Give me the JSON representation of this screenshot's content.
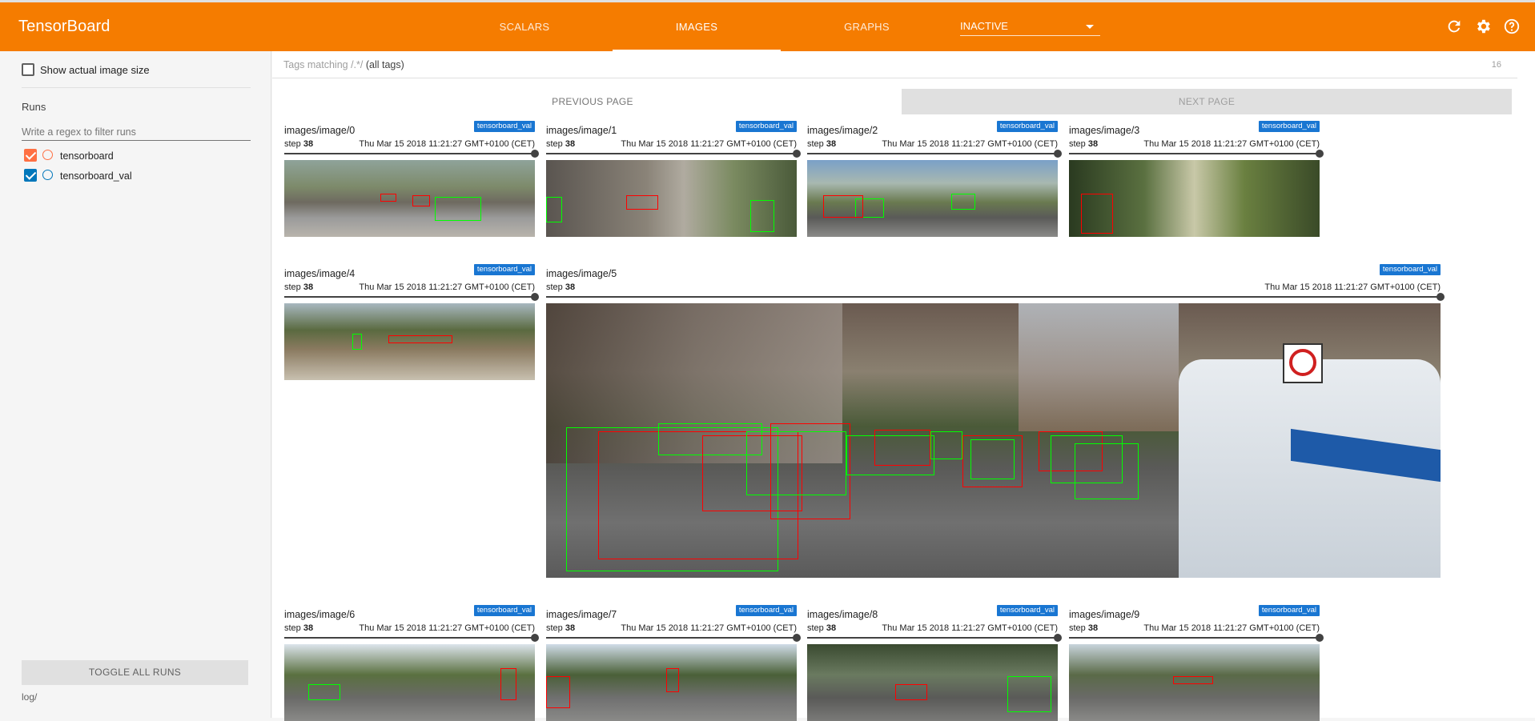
{
  "topbar": {
    "brand": "TensorBoard",
    "tabs": [
      {
        "label": "SCALARS"
      },
      {
        "label": "IMAGES"
      },
      {
        "label": "GRAPHS"
      }
    ],
    "inactive_label": "INACTIVE",
    "icons": [
      "refresh-icon",
      "settings-icon",
      "help-icon"
    ]
  },
  "sidebar": {
    "show_actual_size": "Show actual image size",
    "runs_title": "Runs",
    "regex_placeholder": "Write a regex to filter runs",
    "runs": [
      {
        "name": "tensorboard",
        "color": "#ff7043",
        "checked": true
      },
      {
        "name": "tensorboard_val",
        "color": "#0077bb",
        "checked": true
      }
    ],
    "toggle_all": "TOGGLE ALL RUNS",
    "logdir": "log/"
  },
  "main": {
    "tag_prefix": "Tags matching ",
    "tag_regex": "/.*/",
    "tag_suffix": " (all tags)",
    "tag_count": "16",
    "prev_page": "PREVIOUS PAGE",
    "next_page": "NEXT PAGE",
    "cards": [
      {
        "title": "images/image/0",
        "badge": "tensorboard_val",
        "step_label": "step",
        "step": "38",
        "wall": "Thu Mar 15 2018 11:21:27 GMT+0100 (CET)"
      },
      {
        "title": "images/image/1",
        "badge": "tensorboard_val",
        "step_label": "step",
        "step": "38",
        "wall": "Thu Mar 15 2018 11:21:27 GMT+0100 (CET)"
      },
      {
        "title": "images/image/2",
        "badge": "tensorboard_val",
        "step_label": "step",
        "step": "38",
        "wall": "Thu Mar 15 2018 11:21:27 GMT+0100 (CET)"
      },
      {
        "title": "images/image/3",
        "badge": "tensorboard_val",
        "step_label": "step",
        "step": "38",
        "wall": "Thu Mar 15 2018 11:21:27 GMT+0100 (CET)"
      },
      {
        "title": "images/image/4",
        "badge": "tensorboard_val",
        "step_label": "step",
        "step": "38",
        "wall": "Thu Mar 15 2018 11:21:27 GMT+0100 (CET)"
      },
      {
        "title": "images/image/5",
        "badge": "tensorboard_val",
        "step_label": "step",
        "step": "38",
        "wall": "Thu Mar 15 2018 11:21:27 GMT+0100 (CET)"
      },
      {
        "title": "images/image/6",
        "badge": "tensorboard_val",
        "step_label": "step",
        "step": "38",
        "wall": "Thu Mar 15 2018 11:21:27 GMT+0100 (CET)"
      },
      {
        "title": "images/image/7",
        "badge": "tensorboard_val",
        "step_label": "step",
        "step": "38",
        "wall": "Thu Mar 15 2018 11:21:27 GMT+0100 (CET)"
      },
      {
        "title": "images/image/8",
        "badge": "tensorboard_val",
        "step_label": "step",
        "step": "38",
        "wall": "Thu Mar 15 2018 11:21:27 GMT+0100 (CET)"
      },
      {
        "title": "images/image/9",
        "badge": "tensorboard_val",
        "step_label": "step",
        "step": "38",
        "wall": "Thu Mar 15 2018 11:21:27 GMT+0100 (CET)"
      }
    ],
    "colors": {
      "accent": "#f57c00",
      "badge": "#1976d2",
      "box_red": "#ff0000",
      "box_green": "#00ff00"
    }
  }
}
